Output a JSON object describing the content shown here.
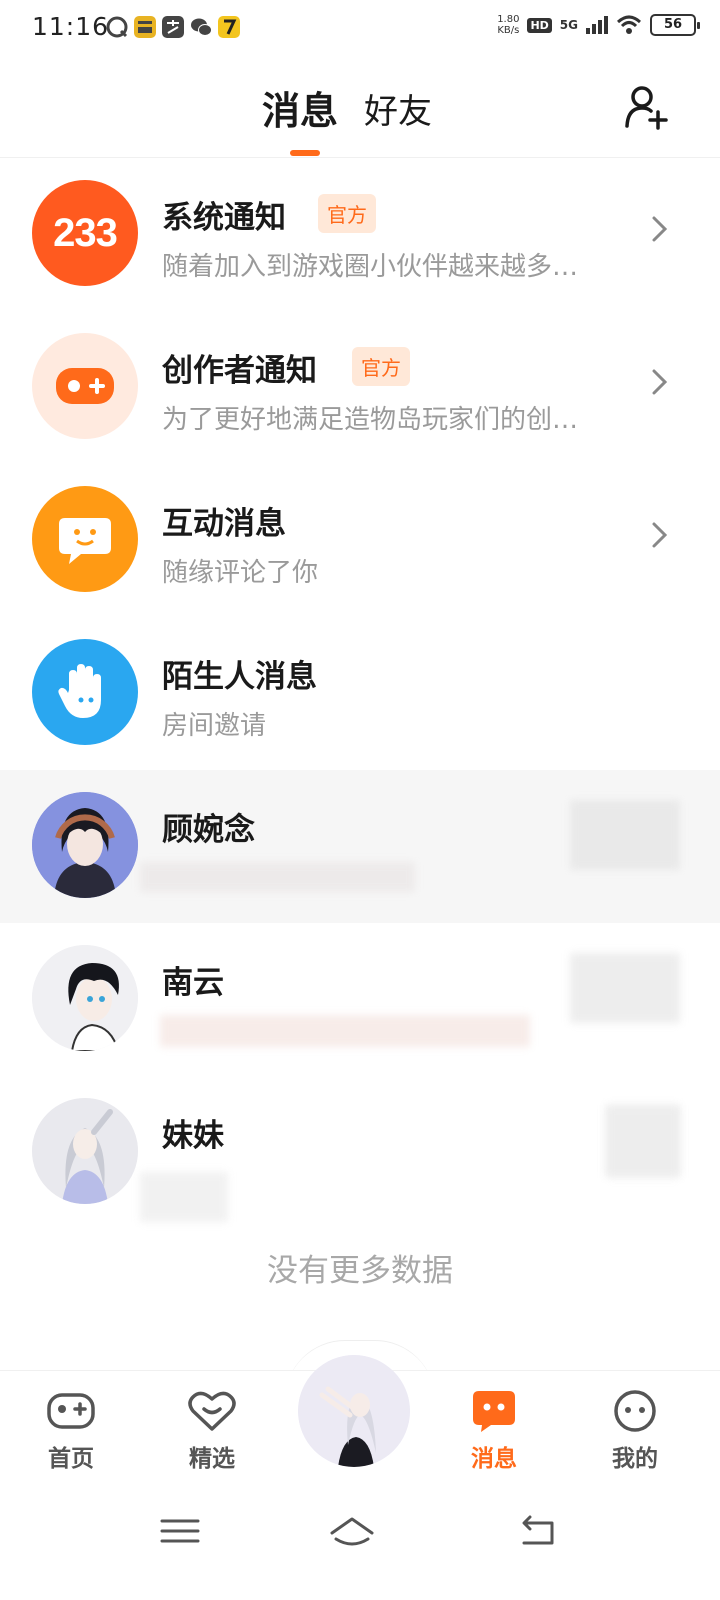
{
  "status_bar": {
    "time": "11:16",
    "net_speed_value": "1.80",
    "net_speed_unit": "KB/s",
    "hd": "HD",
    "network": "5G",
    "battery": "56"
  },
  "header": {
    "tabs": [
      {
        "label": "消息",
        "active": true
      },
      {
        "label": "好友",
        "active": false
      }
    ],
    "add_friend_icon": "add-user-icon"
  },
  "messages": [
    {
      "title": "系统通知",
      "badge": "官方",
      "subtitle": "随着加入到游戏圈小伙伴越来越多…",
      "icon": "233-logo",
      "icon_text": "233",
      "color": "#ff5a1f",
      "chevron": true
    },
    {
      "title": "创作者通知",
      "badge": "官方",
      "subtitle": "为了更好地满足造物岛玩家们的创…",
      "icon": "gamepad-icon",
      "color": "#ff6a1a",
      "chevron": true
    },
    {
      "title": "互动消息",
      "badge": "",
      "subtitle": "随缘评论了你",
      "icon": "chat-smile-icon",
      "color": "#ff9a14",
      "chevron": true
    },
    {
      "title": "陌生人消息",
      "badge": "",
      "subtitle": "房间邀请",
      "icon": "waving-hand-icon",
      "color": "#2aa7f0",
      "chevron": false
    },
    {
      "title": "顾婉念",
      "badge": "",
      "subtitle": "",
      "icon": "avatar-anime-girl",
      "chevron": false
    },
    {
      "title": "南云",
      "badge": "",
      "subtitle": "",
      "icon": "avatar-anime-boy",
      "chevron": false
    },
    {
      "title": "妹妹",
      "badge": "",
      "subtitle": "",
      "icon": "avatar-anime-silver",
      "chevron": false
    }
  ],
  "footer_text": "没有更多数据",
  "bottom_nav": [
    {
      "label": "首页",
      "icon": "gamepad-icon",
      "active": false
    },
    {
      "label": "精选",
      "icon": "heart-smile-icon",
      "active": false
    },
    {
      "label": "",
      "icon": "center-avatar",
      "active": false
    },
    {
      "label": "消息",
      "icon": "message-icon",
      "active": true
    },
    {
      "label": "我的",
      "icon": "face-icon",
      "active": false
    }
  ],
  "colors": {
    "accent": "#ff6a1a",
    "badge_bg": "#ffe8d8",
    "muted": "#9a9a9a"
  }
}
